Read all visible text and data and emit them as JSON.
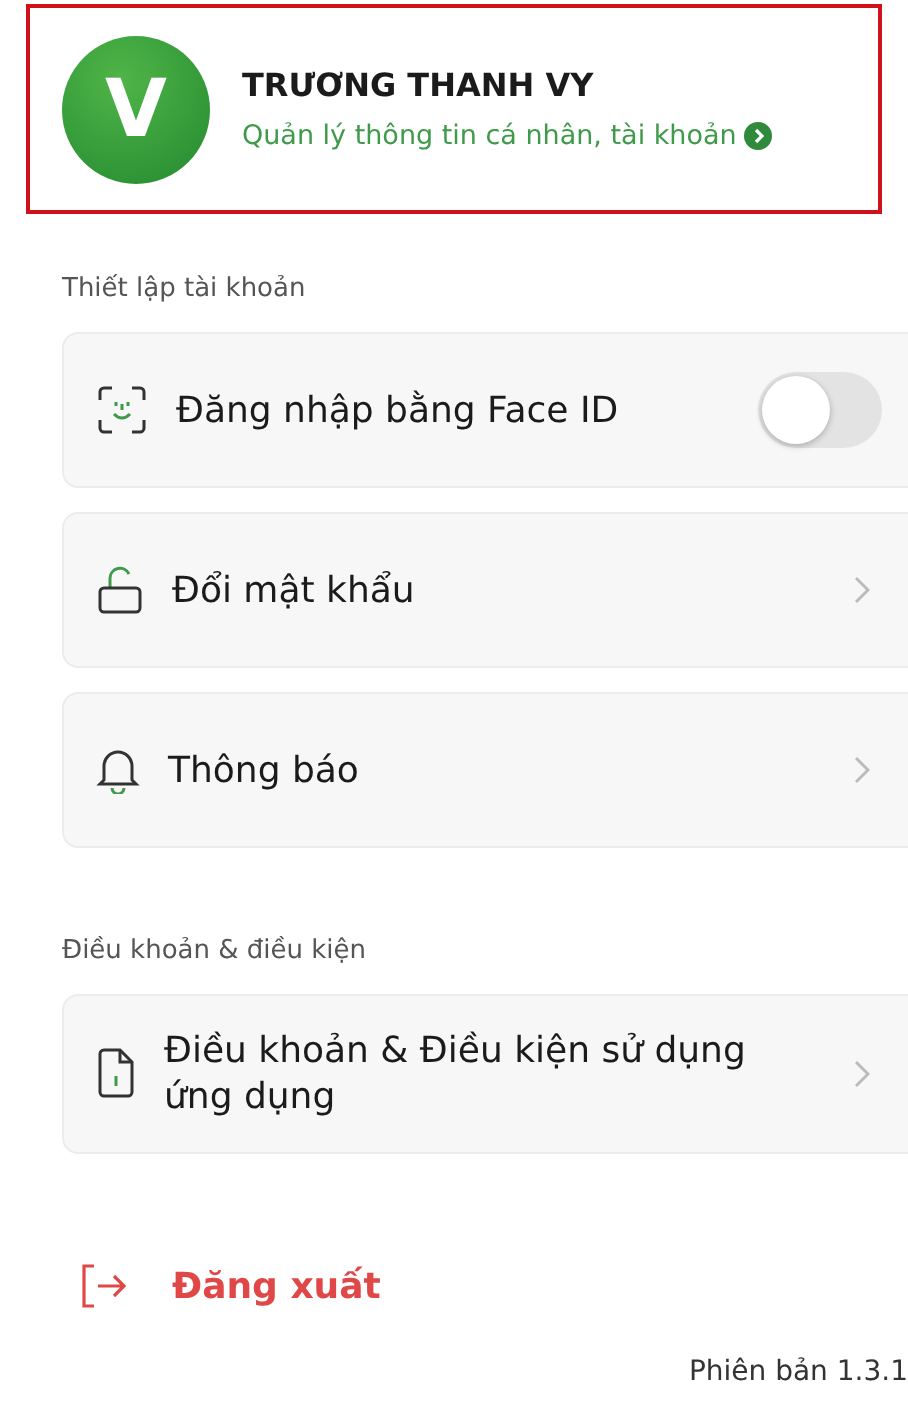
{
  "profile": {
    "initial": "V",
    "name": "TRƯƠNG THANH VY",
    "subtitle": "Quản lý thông tin cá nhân, tài khoản"
  },
  "sections": [
    {
      "title": "Thiết lập tài khoản",
      "items": [
        {
          "kind": "toggle",
          "label": "Đăng nhập bằng Face ID",
          "on": false
        },
        {
          "kind": "link",
          "label": "Đổi mật khẩu"
        },
        {
          "kind": "link",
          "label": "Thông báo"
        }
      ]
    },
    {
      "title": "Điều khoản & điều kiện",
      "items": [
        {
          "kind": "link",
          "label": "Điều khoản & Điều kiện sử dụng ứng dụng"
        }
      ]
    }
  ],
  "logout": "Đăng xuất",
  "version": "Phiên bản 1.3.1"
}
